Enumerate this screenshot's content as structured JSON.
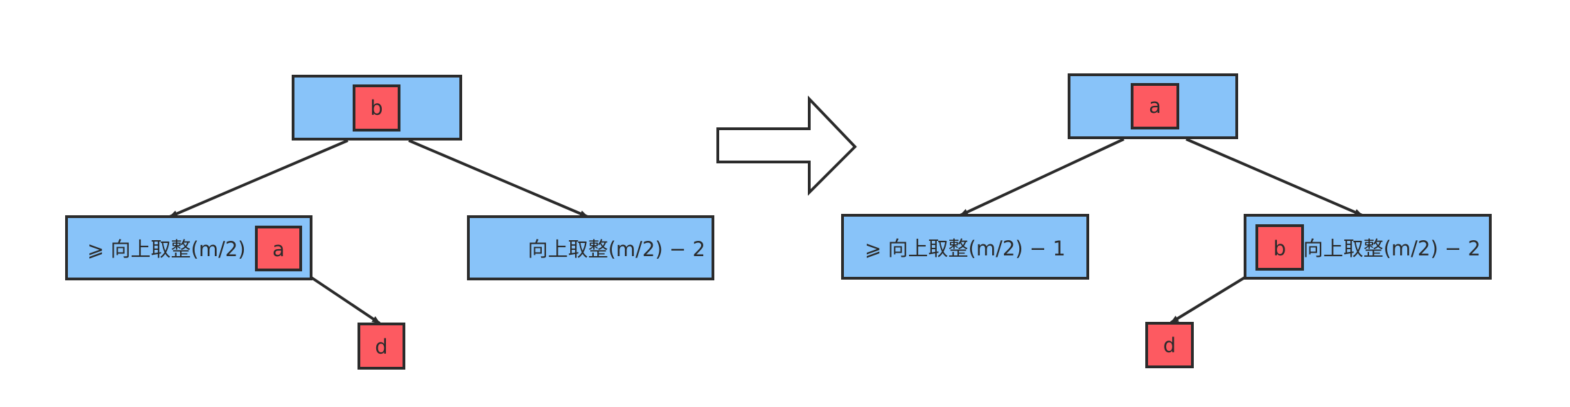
{
  "before": {
    "root_key": "b",
    "left_child": {
      "label": "⩾ 向上取整(m/2)",
      "key": "a"
    },
    "right_child": {
      "label": "向上取整(m/2) − 2"
    },
    "grandchild_key": "d"
  },
  "after": {
    "root_key": "a",
    "left_child": {
      "label": "⩾ 向上取整(m/2) − 1"
    },
    "right_child": {
      "label": "向上取整(m/2) − 2",
      "key": "b"
    },
    "grandchild_key": "d"
  },
  "colors": {
    "node_fill": "#88c3f9",
    "key_fill": "#fd5a61",
    "stroke": "#2b2b2b",
    "transform_arrow_fill": "#ffffff"
  }
}
